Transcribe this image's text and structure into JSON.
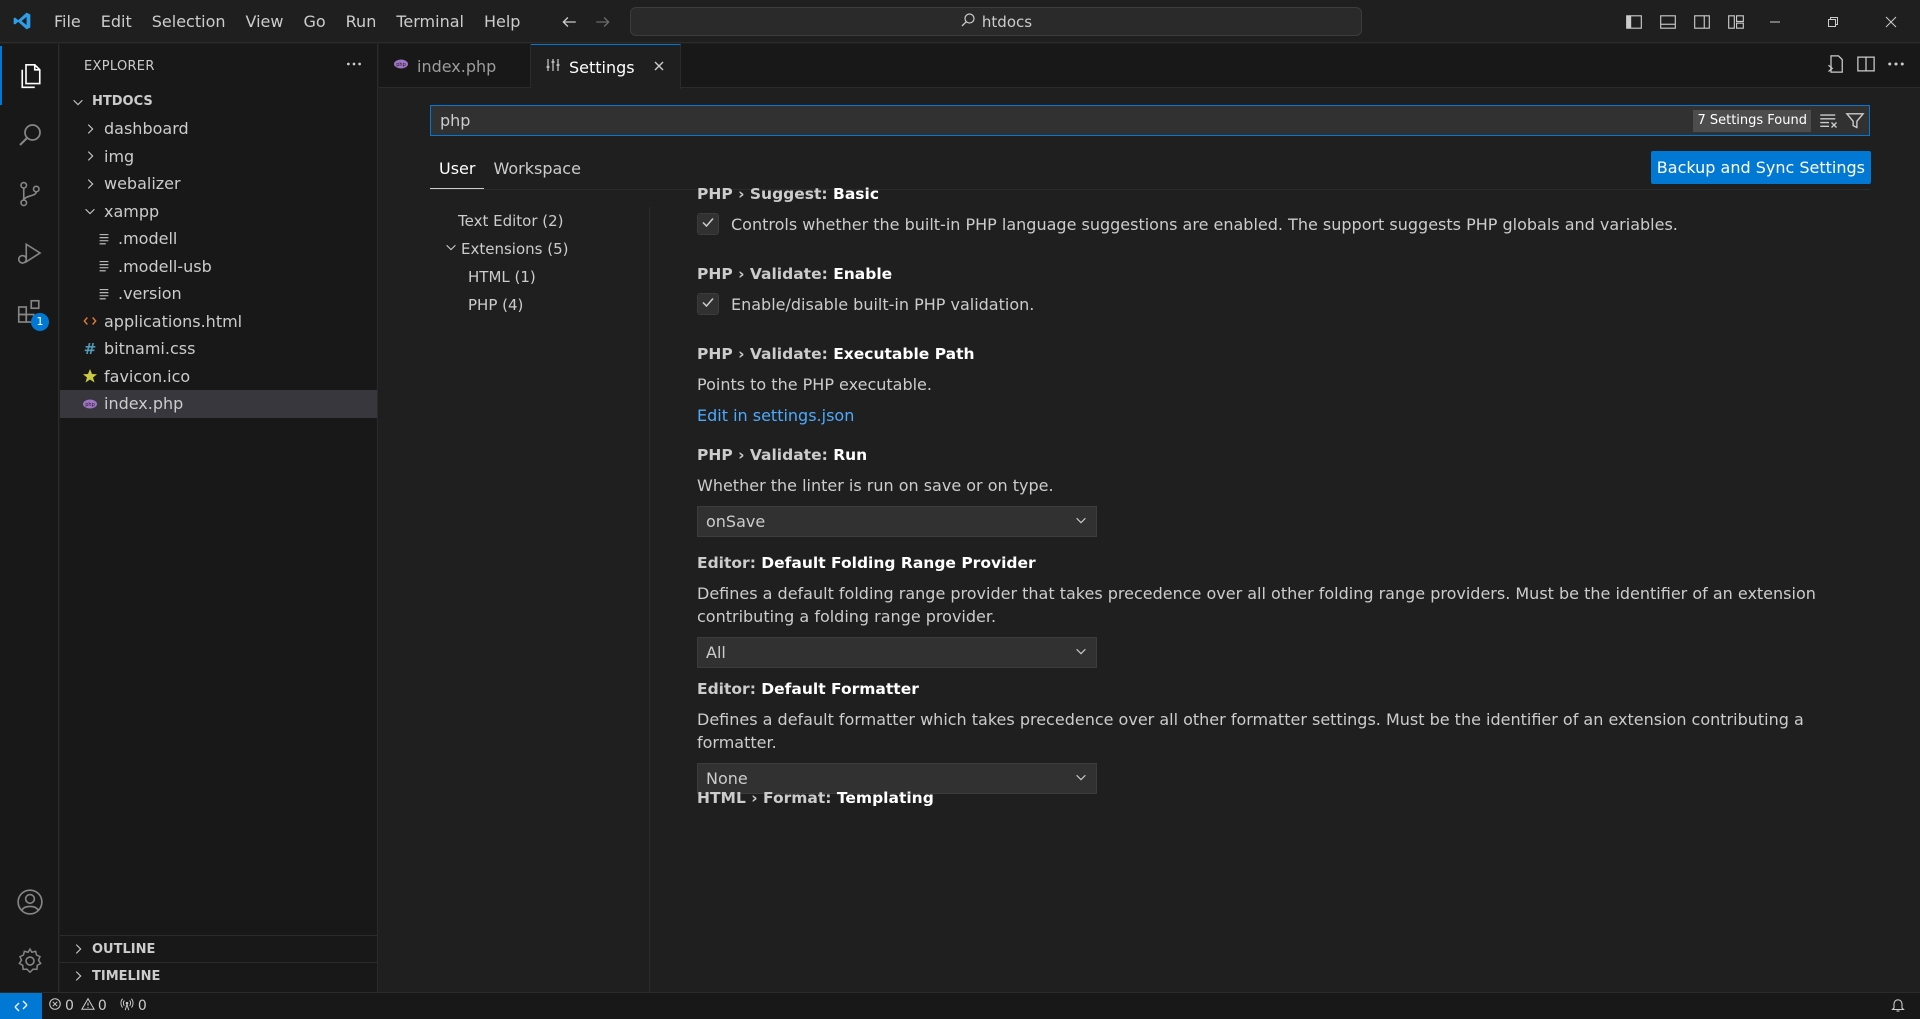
{
  "menubar": [
    "File",
    "Edit",
    "Selection",
    "View",
    "Go",
    "Run",
    "Terminal",
    "Help"
  ],
  "command_center": {
    "text": "htdocs"
  },
  "sidebar": {
    "title": "EXPLORER",
    "root": "HTDOCS",
    "tree": [
      {
        "label": "dashboard",
        "type": "folder",
        "indent": 0
      },
      {
        "label": "img",
        "type": "folder",
        "indent": 0
      },
      {
        "label": "webalizer",
        "type": "folder",
        "indent": 0
      },
      {
        "label": "xampp",
        "type": "folder-open",
        "indent": 0
      },
      {
        "label": ".modell",
        "type": "file",
        "indent": 1
      },
      {
        "label": ".modell-usb",
        "type": "file",
        "indent": 1
      },
      {
        "label": ".version",
        "type": "file",
        "indent": 1
      },
      {
        "label": "applications.html",
        "type": "html",
        "indent": 0
      },
      {
        "label": "bitnami.css",
        "type": "css",
        "indent": 0
      },
      {
        "label": "favicon.ico",
        "type": "ico",
        "indent": 0
      },
      {
        "label": "index.php",
        "type": "php",
        "indent": 0
      }
    ],
    "outline": "OUTLINE",
    "timeline": "TIMELINE"
  },
  "activity_badge": "1",
  "tabs": [
    {
      "label": "index.php",
      "active": false
    },
    {
      "label": "Settings",
      "active": true
    }
  ],
  "settings": {
    "search_value": "php",
    "found_count": "7 Settings Found",
    "scope_tabs": [
      "User",
      "Workspace"
    ],
    "sync_button": "Backup and Sync Settings",
    "toc": [
      {
        "label": "Text Editor (2)",
        "indent": 0,
        "chevron": false
      },
      {
        "label": "Extensions (5)",
        "indent": 0,
        "chevron": true
      },
      {
        "label": "HTML (1)",
        "indent": 1,
        "chevron": false
      },
      {
        "label": "PHP (4)",
        "indent": 1,
        "chevron": false
      }
    ],
    "items": [
      {
        "category": "PHP › Suggest: ",
        "name": "Basic",
        "kind": "checkbox",
        "checked": true,
        "description": "Controls whether the built-in PHP language suggestions are enabled. The support suggests PHP globals and variables."
      },
      {
        "category": "PHP › Validate: ",
        "name": "Enable",
        "kind": "checkbox",
        "checked": true,
        "description": "Enable/disable built-in PHP validation."
      },
      {
        "category": "PHP › Validate: ",
        "name": "Executable Path",
        "kind": "link",
        "description": "Points to the PHP executable.",
        "link": "Edit in settings.json"
      },
      {
        "category": "PHP › Validate: ",
        "name": "Run",
        "kind": "dropdown",
        "description": "Whether the linter is run on save or on type.",
        "value": "onSave"
      },
      {
        "category": "Editor: ",
        "name": "Default Folding Range Provider",
        "kind": "dropdown",
        "description": "Defines a default folding range provider that takes precedence over all other folding range providers. Must be the identifier of an extension contributing a folding range provider.",
        "value": "All"
      },
      {
        "category": "Editor: ",
        "name": "Default Formatter",
        "kind": "dropdown",
        "description": "Defines a default formatter which takes precedence over all other formatter settings. Must be the identifier of an extension contributing a formatter.",
        "value": "None"
      },
      {
        "category": "HTML › Format: ",
        "name": "Templating",
        "kind": "heading"
      }
    ]
  },
  "statusbar": {
    "errors": "0",
    "warnings": "0",
    "ports": "0"
  }
}
